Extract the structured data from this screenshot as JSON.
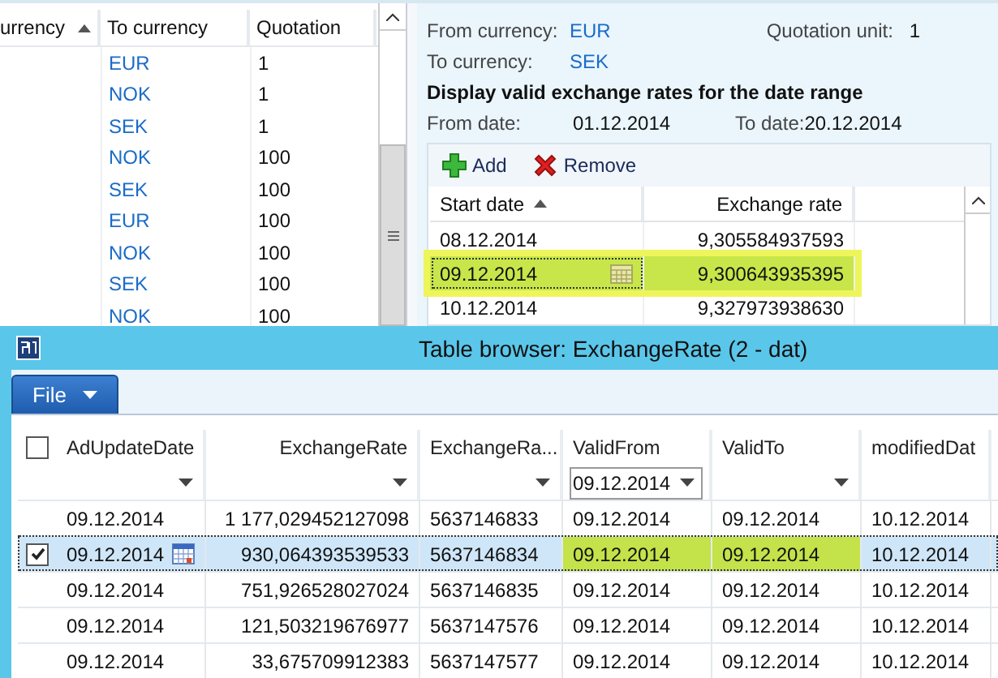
{
  "currency_grid": {
    "columns": [
      {
        "label": "urrency",
        "sorted": true
      },
      {
        "label": "To currency",
        "sorted": false
      },
      {
        "label": "Quotation",
        "sorted": false
      }
    ],
    "rows": [
      {
        "to": "EUR",
        "quotation": "1"
      },
      {
        "to": "NOK",
        "quotation": "1"
      },
      {
        "to": "SEK",
        "quotation": "1"
      },
      {
        "to": "NOK",
        "quotation": "100"
      },
      {
        "to": "SEK",
        "quotation": "100"
      },
      {
        "to": "EUR",
        "quotation": "100"
      },
      {
        "to": "NOK",
        "quotation": "100"
      },
      {
        "to": "SEK",
        "quotation": "100"
      },
      {
        "to": "NOK",
        "quotation": "100"
      }
    ]
  },
  "detail": {
    "from_currency_label": "From currency:",
    "from_currency": "EUR",
    "quotation_unit_label": "Quotation unit:",
    "quotation_unit": "1",
    "to_currency_label": "To currency:",
    "to_currency": "SEK",
    "heading": "Display valid exchange rates for the date range",
    "from_date_label": "From date:",
    "from_date": "01.12.2014",
    "to_date_label": "To date:",
    "to_date": "20.12.2014",
    "buttons": [
      {
        "label": "Add",
        "kind": "add"
      },
      {
        "label": "Remove",
        "kind": "remove"
      }
    ],
    "rates_grid": {
      "columns": [
        {
          "label": "Start date",
          "sorted": true
        },
        {
          "label": "Exchange rate",
          "sorted": false
        }
      ],
      "rows": [
        {
          "start_date": "08.12.2014",
          "rate": "9,305584937593",
          "selected": false,
          "highlighted": false
        },
        {
          "start_date": "09.12.2014",
          "rate": "9,300643935395",
          "selected": true,
          "highlighted": true
        },
        {
          "start_date": "10.12.2014",
          "rate": "9,327973938630",
          "selected": false,
          "highlighted": false
        }
      ]
    }
  },
  "table_browser": {
    "title": "Table browser: ExchangeRate (2 - dat)",
    "menu": "File",
    "header_checked": false,
    "columns": [
      {
        "label": "AdUpdateDate",
        "kind": "text"
      },
      {
        "label": "ExchangeRate",
        "kind": "number"
      },
      {
        "label": "ExchangeRa...",
        "kind": "text"
      },
      {
        "label": "ValidFrom",
        "kind": "text",
        "filter": "09.12.2014"
      },
      {
        "label": "ValidTo",
        "kind": "text"
      },
      {
        "label": "modifiedDat",
        "kind": "text"
      }
    ],
    "rows": [
      {
        "checked": false,
        "selected": false,
        "cells": [
          {
            "text": "09.12.2014",
            "highlighted": false
          },
          {
            "text": "1 177,029452127098",
            "highlighted": false
          },
          {
            "text": "5637146833",
            "highlighted": false
          },
          {
            "text": "09.12.2014",
            "highlighted": false
          },
          {
            "text": "09.12.2014",
            "highlighted": false
          },
          {
            "text": "10.12.2014",
            "highlighted": false
          }
        ]
      },
      {
        "checked": true,
        "selected": true,
        "cells": [
          {
            "text": "09.12.2014",
            "highlighted": false
          },
          {
            "text": "930,064393539533",
            "highlighted": false
          },
          {
            "text": "5637146834",
            "highlighted": false
          },
          {
            "text": "09.12.2014",
            "highlighted": true
          },
          {
            "text": "09.12.2014",
            "highlighted": true
          },
          {
            "text": "10.12.2014",
            "highlighted": false
          }
        ]
      },
      {
        "checked": false,
        "selected": false,
        "cells": [
          {
            "text": "09.12.2014",
            "highlighted": false
          },
          {
            "text": "751,926528027024",
            "highlighted": false
          },
          {
            "text": "5637146835",
            "highlighted": false
          },
          {
            "text": "09.12.2014",
            "highlighted": false
          },
          {
            "text": "09.12.2014",
            "highlighted": false
          },
          {
            "text": "10.12.2014",
            "highlighted": false
          }
        ]
      },
      {
        "checked": false,
        "selected": false,
        "cells": [
          {
            "text": "09.12.2014",
            "highlighted": false
          },
          {
            "text": "121,503219676977",
            "highlighted": false
          },
          {
            "text": "5637147576",
            "highlighted": false
          },
          {
            "text": "09.12.2014",
            "highlighted": false
          },
          {
            "text": "09.12.2014",
            "highlighted": false
          },
          {
            "text": "10.12.2014",
            "highlighted": false
          }
        ]
      },
      {
        "checked": false,
        "selected": false,
        "cells": [
          {
            "text": "09.12.2014",
            "highlighted": false
          },
          {
            "text": "33,675709912383",
            "highlighted": false
          },
          {
            "text": "5637147577",
            "highlighted": false
          },
          {
            "text": "09.12.2014",
            "highlighted": false
          },
          {
            "text": "09.12.2014",
            "highlighted": false
          },
          {
            "text": "10.12.2014",
            "highlighted": false
          }
        ]
      }
    ]
  }
}
